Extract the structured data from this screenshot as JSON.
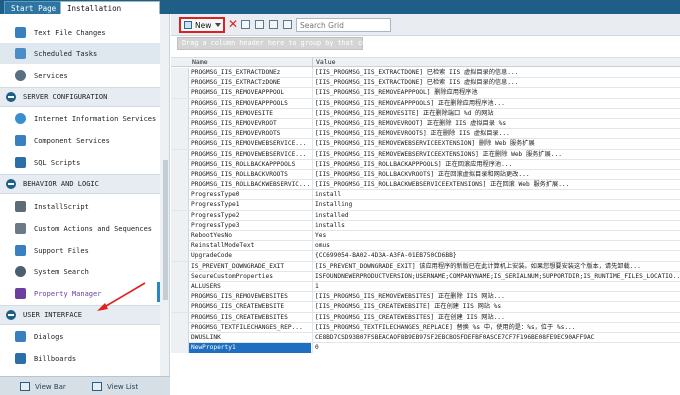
{
  "tabs": [
    {
      "label": "Start Page"
    },
    {
      "label": "Installation Designer"
    }
  ],
  "sidebar": {
    "items": [
      {
        "label": "Text File Changes",
        "icon": "text-file-icon",
        "color": "#3a7fbf"
      },
      {
        "label": "Scheduled Tasks",
        "icon": "calendar-icon",
        "color": "#4c8cc9"
      },
      {
        "label": "Services",
        "icon": "gear-icon",
        "color": "#5a6f80"
      },
      {
        "label": "Internet Information Services",
        "icon": "globe-icon",
        "color": "#3a8fd1"
      },
      {
        "label": "Component Services",
        "icon": "component-icon",
        "color": "#3a7fbf"
      },
      {
        "label": "SQL Scripts",
        "icon": "database-icon",
        "color": "#2b6ea8"
      },
      {
        "label": "InstallScript",
        "icon": "script-icon",
        "color": "#5b6b78"
      },
      {
        "label": "Custom Actions and Sequences",
        "icon": "actions-icon",
        "color": "#6a7a88"
      },
      {
        "label": "Support Files",
        "icon": "support-files-icon",
        "color": "#3a7fbf"
      },
      {
        "label": "System Search",
        "icon": "search-icon",
        "color": "#4a5f70"
      },
      {
        "label": "Property Manager",
        "icon": "property-icon",
        "color": "#6b3fa0"
      },
      {
        "label": "Dialogs",
        "icon": "dialog-icon",
        "color": "#3a7fbf"
      },
      {
        "label": "Billboards",
        "icon": "billboard-icon",
        "color": "#2b6ea8"
      }
    ],
    "groups": [
      {
        "label": "SERVER CONFIGURATION"
      },
      {
        "label": "BEHAVIOR AND LOGIC"
      },
      {
        "label": "USER INTERFACE"
      }
    ]
  },
  "viewbar": {
    "view_bar": "View Bar",
    "view_list": "View List"
  },
  "toolbar": {
    "new_label": "New",
    "search_placeholder": "Search Grid"
  },
  "grid": {
    "group_hint": "Drag a column header here to group by that column.",
    "columns": [
      "Name",
      "Value"
    ],
    "rows": [
      {
        "name": "PROGMSG_IIS_EXTRACTDONEz",
        "value": "[IIS_PROGMSG_IIS_EXTRACTDONE] 已检索 IIS 虚拟目录的信息..."
      },
      {
        "name": "PROGMSG_IIS_EXTRACTzDONE",
        "value": "[IIS_PROGMSG_IIS_EXTRACTDONE] 已检索 IIS 虚拟目录的信息..."
      },
      {
        "name": "PROGMSG_IIS_REMOVEAPPPOOL",
        "value": "[IIS_PROGMSG_IIS_REMOVEAPPPOOL] 删除应用程序池"
      },
      {
        "name": "PROGMSG_IIS_REMOVEAPPPOOLS",
        "value": "[IIS_PROGMSG_IIS_REMOVEAPPPOOLS] 正在删除应用程序池..."
      },
      {
        "name": "PROGMSG_IIS_REMOVESITE",
        "value": "[IIS_PROGMSG_IIS_REMOVESITE] 正在删除端口 %d 的网站"
      },
      {
        "name": "PROGMSG_IIS_REMOVEVROOT",
        "value": "[IIS_PROGMSG_IIS_REMOVEVROOT] 正在删除 IIS 虚拟目录 %s"
      },
      {
        "name": "PROGMSG_IIS_REMOVEVROOTS",
        "value": "[IIS_PROGMSG_IIS_REMOVEVROOTS] 正在删除 IIS 虚拟目录..."
      },
      {
        "name": "PROGMSG_IIS_REMOVEWEBSERVICE...",
        "value": "[IIS_PROGMSG_IIS_REMOVEWEBSERVICEEXTENSION] 删除 Web 服务扩展"
      },
      {
        "name": "PROGMSG_IIS_REMOVEWEBSERVICE...",
        "value": "[IIS_PROGMSG_IIS_REMOVEWEBSERVICEEXTENSIONS] 正在删除 Web 服务扩展..."
      },
      {
        "name": "PROGMSG_IIS_ROLLBACKAPPPOOLS",
        "value": "[IIS_PROGMSG_IIS_ROLLBACKAPPPOOLS] 正在回滚应用程序池..."
      },
      {
        "name": "PROGMSG_IIS_ROLLBACKVROOTS",
        "value": "[IIS_PROGMSG_IIS_ROLLBACKVROOTS] 正在回滚虚拟目录和网站更改..."
      },
      {
        "name": "PROGMSG_IIS_ROLLBACKWEBSERVIC...",
        "value": "[IIS_PROGMSG_IIS_ROLLBACKWEBSERVICEEXTENSIONS] 正在回滚 Web 服务扩展..."
      },
      {
        "name": "ProgressType0",
        "value": "install"
      },
      {
        "name": "ProgressType1",
        "value": "Installing"
      },
      {
        "name": "ProgressType2",
        "value": "installed"
      },
      {
        "name": "ProgressType3",
        "value": "installs"
      },
      {
        "name": "RebootYesNo",
        "value": "Yes"
      },
      {
        "name": "ReinstallModeText",
        "value": "omus"
      },
      {
        "name": "UpgradeCode",
        "value": "{CC699054-BA02-4D3A-A3FA-01EB750CD6BB}"
      },
      {
        "name": "IS_PREVENT_DOWNGRADE_EXIT",
        "value": "[IS_PREVENT_DOWNGRADE_EXIT] 该应用程序的新版已在此计算机上安装。如果您想要安装这个版本，请先卸载..."
      },
      {
        "name": "SecureCustomProperties",
        "value": "ISFOUNDNEWERPRODUCTVERSION;USERNAME;COMPANYNAME;IS_SERIALNUM;SUPPORTDIR;IS_RUNTIME_FILES_LOCATIO..."
      },
      {
        "name": "ALLUSERS",
        "value": "1"
      },
      {
        "name": "PROGMSG_IIS_REMOVEWEBSITES",
        "value": "[IIS_PROGMSG_IIS_REMOVEWEBSITES] 正在删除 IIS 网站..."
      },
      {
        "name": "PROGMSG_IIS_CREATEWEBSITE",
        "value": "[IIS_PROGMSG_IIS_CREATEWEBSITE] 正在创建 IIS 网站 %s"
      },
      {
        "name": "PROGMSG_IIS_CREATEWEBSITES",
        "value": "[IIS_PROGMSG_IIS_CREATEWEBSITES] 正在创建 IIS 网站..."
      },
      {
        "name": "PROGMSG_TEXTFILECHANGES_REP...",
        "value": "[IIS_PROGMSG_TEXTFILECHANGES_REPLACE] 替换 %s 中，使用的是：%s，位于 %s..."
      },
      {
        "name": "DWUSLINK",
        "value": "CE8BD7CSD93B07FSBEACAOF8B9EB97SF2EBCBOSFDEFBF0ASCE7CF7F196BE08FE9EC90AFF9AC"
      },
      {
        "name": "NewProperty1",
        "value": "0"
      }
    ]
  }
}
